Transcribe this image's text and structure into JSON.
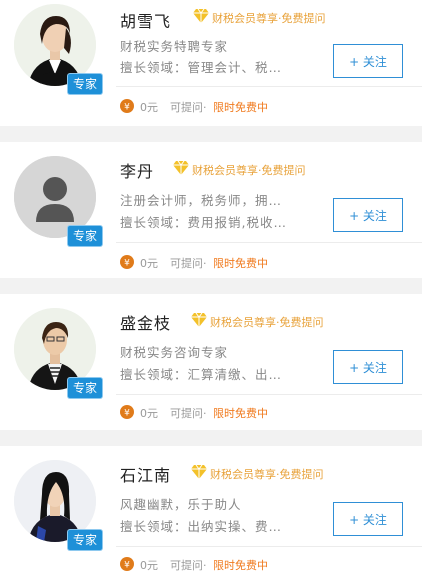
{
  "experts": [
    {
      "name": "胡雪飞",
      "vip_text": "财税会员尊享·免费提问",
      "title": "财税实务特聘专家",
      "specialty": "擅长领域：管理会计、税…",
      "badge": "专家",
      "follow_label": "+ 关注",
      "price": "0元",
      "askable": "可提问·",
      "free_text": "限时免费中"
    },
    {
      "name": "李丹",
      "vip_text": "财税会员尊享·免费提问",
      "title": "注册会计师，税务师，拥…",
      "specialty": "擅长领域：费用报销,税收…",
      "badge": "专家",
      "follow_label": "+ 关注",
      "price": "0元",
      "askable": "可提问·",
      "free_text": "限时免费中"
    },
    {
      "name": "盛金枝",
      "vip_text": "财税会员尊享·免费提问",
      "title": "财税实务咨询专家",
      "specialty": "擅长领域：汇算清缴、出…",
      "badge": "专家",
      "follow_label": "+ 关注",
      "price": "0元",
      "askable": "可提问·",
      "free_text": "限时免费中"
    },
    {
      "name": "石江南",
      "vip_text": "财税会员尊享·免费提问",
      "title": "风趣幽默，乐于助人",
      "specialty": "擅长领域：出纳实操、费…",
      "badge": "专家",
      "follow_label": "+ 关注",
      "price": "0元",
      "askable": "可提问·",
      "free_text": "限时免费中"
    }
  ],
  "colors": {
    "accent_blue": "#2f8fd6",
    "badge_blue": "#1e90d8",
    "vip_gold": "#e8a23a",
    "free_orange": "#f07a1e"
  }
}
